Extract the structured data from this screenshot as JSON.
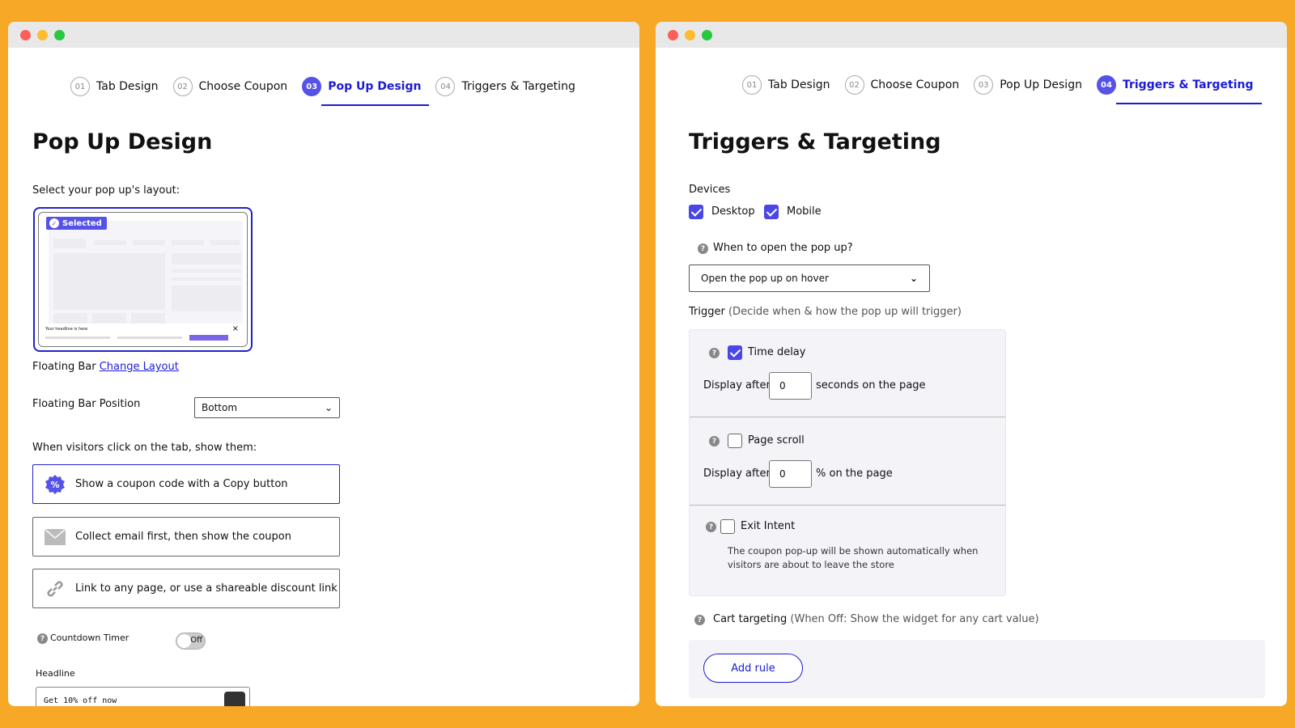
{
  "colors": {
    "background": "#F7A826",
    "accent": "#5552e8",
    "link": "#1b1bd6"
  },
  "steps": [
    {
      "num": "01",
      "label": "Tab Design"
    },
    {
      "num": "02",
      "label": "Choose Coupon"
    },
    {
      "num": "03",
      "label": "Pop Up Design"
    },
    {
      "num": "04",
      "label": "Triggers & Targeting"
    }
  ],
  "left": {
    "active_step": "03",
    "title": "Pop Up Design",
    "layout_label": "Select your pop up's layout:",
    "selected_badge": "Selected",
    "preview_headline": "Your headline is here",
    "layout_name": "Floating Bar",
    "change_layout": "Change Layout",
    "position_label": "Floating Bar Position",
    "position_value": "Bottom",
    "show_label": "When visitors click on the tab, show them:",
    "options": [
      {
        "icon": "coupon-badge-icon",
        "label": "Show a coupon code with a Copy button",
        "selected": true
      },
      {
        "icon": "envelope-icon",
        "label": "Collect email first, then show the coupon",
        "selected": false
      },
      {
        "icon": "link-icon",
        "label": "Link to any page, or use a shareable discount link",
        "selected": false
      }
    ],
    "countdown_label": "Countdown Timer",
    "countdown_state": "Off",
    "headline_label": "Headline",
    "headline_value": "Get 10% off now"
  },
  "right": {
    "active_step": "04",
    "title": "Triggers & Targeting",
    "devices_label": "Devices",
    "desktop": {
      "label": "Desktop",
      "checked": true
    },
    "mobile": {
      "label": "Mobile",
      "checked": true
    },
    "when_label": "When to open the pop up?",
    "when_value": "Open the pop up on hover",
    "trigger_label": "Trigger",
    "trigger_hint": "(Decide when & how the pop up will trigger)",
    "time_delay": {
      "label": "Time delay",
      "checked": true,
      "prefix": "Display after",
      "value": "0",
      "suffix": "seconds on the page"
    },
    "page_scroll": {
      "label": "Page scroll",
      "checked": false,
      "prefix": "Display after",
      "value": "0",
      "suffix": "% on the page"
    },
    "exit_intent": {
      "label": "Exit Intent",
      "checked": false,
      "line1": "The coupon pop-up will be shown automatically when",
      "line2": "visitors are about to leave the store"
    },
    "cart_label": "Cart targeting",
    "cart_hint": "(When Off: Show the widget for any cart value)",
    "add_rule": "Add rule"
  }
}
